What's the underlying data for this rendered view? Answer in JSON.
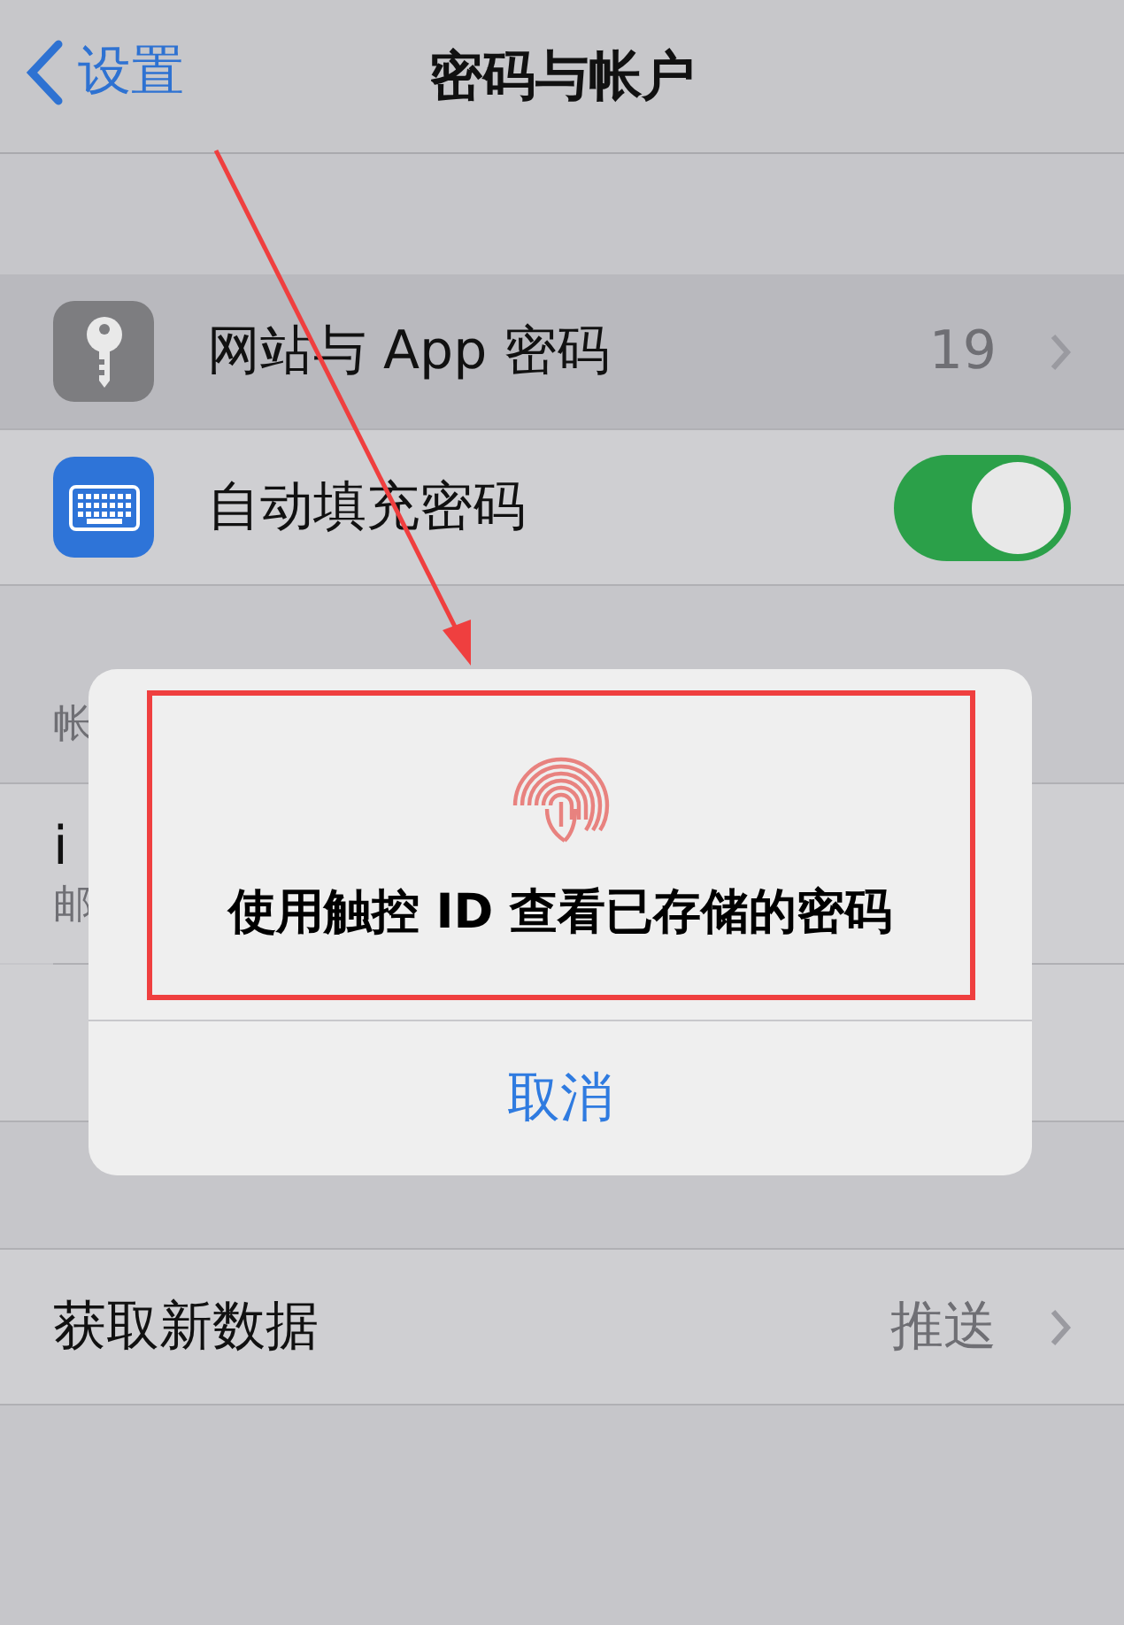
{
  "nav": {
    "back_label": "设置",
    "title": "密码与帐户"
  },
  "rows_top": [
    {
      "kind": "link",
      "label": "网站与 App 密码",
      "value": "19",
      "selected": true
    },
    {
      "kind": "toggle",
      "label": "自动填充密码",
      "on": true,
      "selected": false
    }
  ],
  "section_header": "帐",
  "accounts": [
    {
      "title": "i",
      "subtitle": "邮"
    }
  ],
  "fetch_row": {
    "label": "获取新数据",
    "value": "推送"
  },
  "dialog": {
    "message": "使用触控 ID 查看已存储的密码",
    "cancel": "取消"
  }
}
